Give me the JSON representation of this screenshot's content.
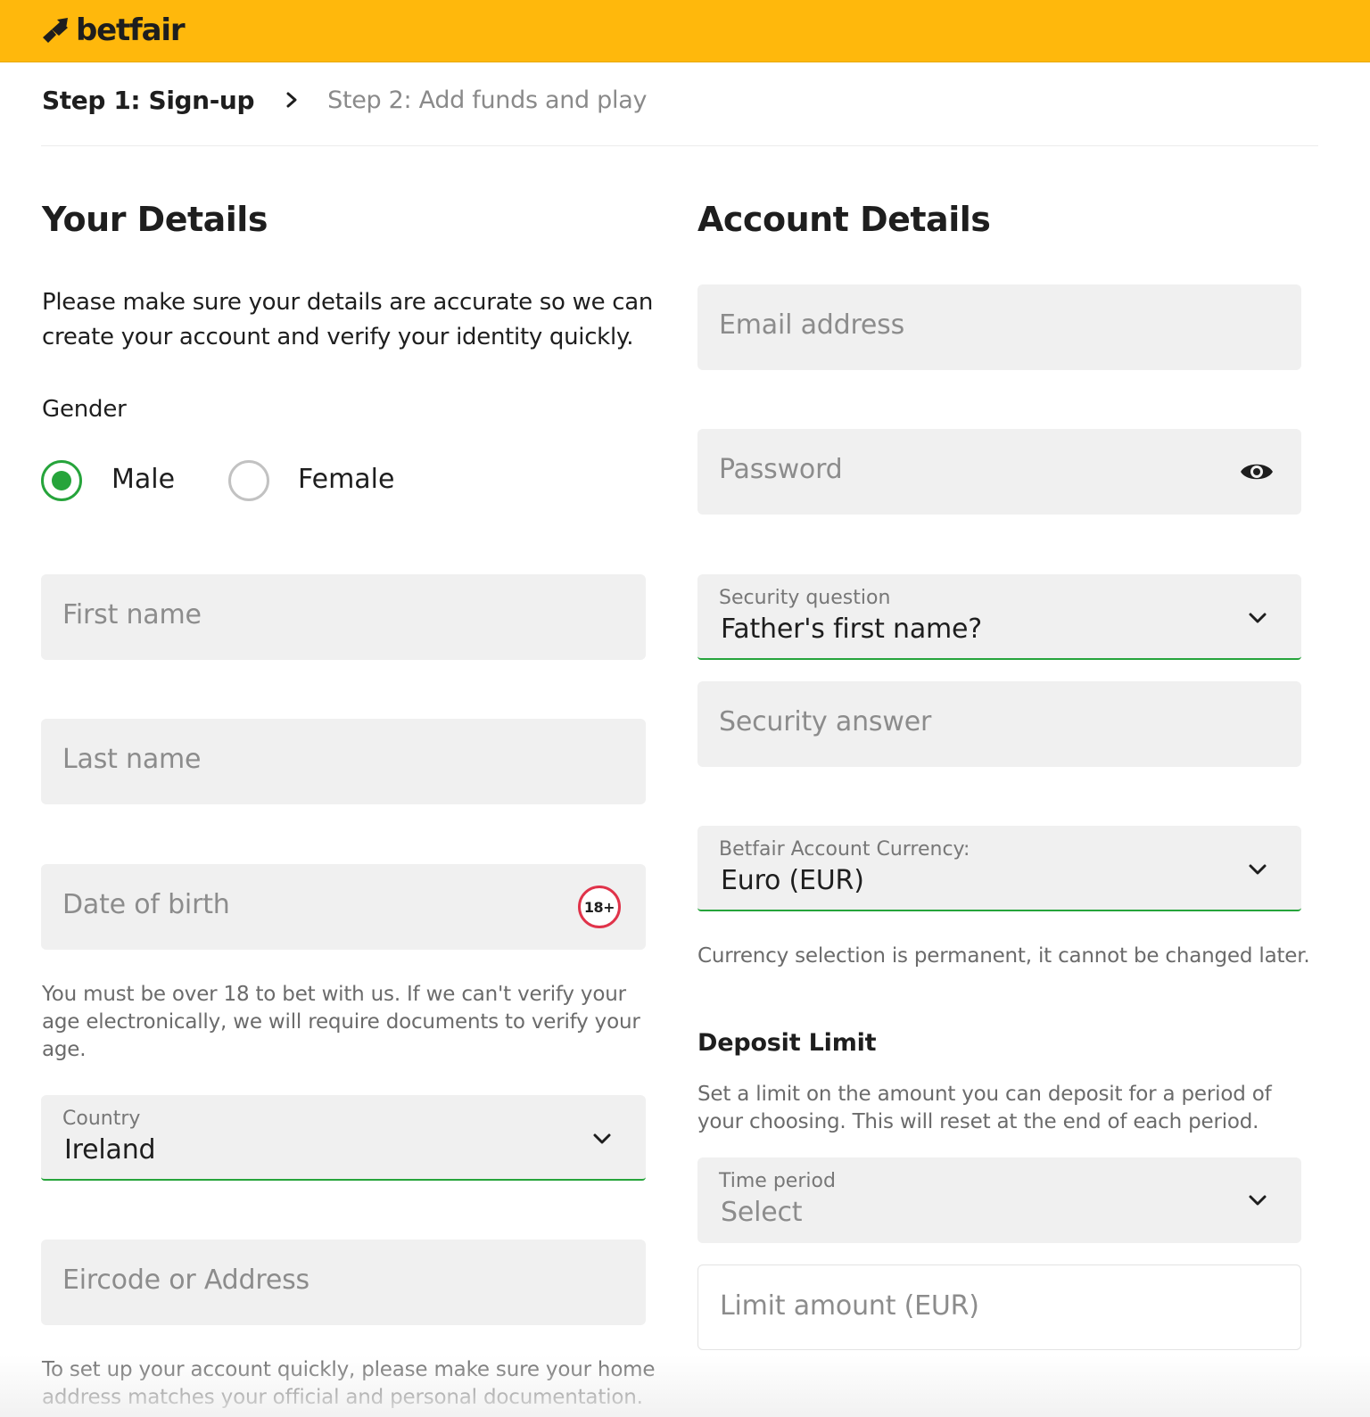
{
  "brand": {
    "name": "betfair",
    "header_color": "#ffb80c",
    "accent_green": "#26a43b",
    "age_badge_color": "#e0334a"
  },
  "steps": {
    "active": "Step 1: Sign-up",
    "inactive": "Step 2: Add funds and play",
    "separator_icon": "chevron-right-icon"
  },
  "your_details": {
    "title": "Your Details",
    "intro": "Please make sure your details are accurate so we can create your account and verify your identity quickly.",
    "gender": {
      "label": "Gender",
      "options": [
        {
          "label": "Male",
          "checked": true
        },
        {
          "label": "Female",
          "checked": false
        }
      ]
    },
    "first_name": {
      "placeholder": "First name",
      "value": ""
    },
    "last_name": {
      "placeholder": "Last name",
      "value": ""
    },
    "dob": {
      "placeholder": "Date of birth",
      "badge": "18+",
      "value": ""
    },
    "dob_help": "You must be over 18 to bet with us. If we can't verify your age electronically, we will require documents to verify your age.",
    "country": {
      "label": "Country",
      "value": "Ireland"
    },
    "address": {
      "placeholder": "Eircode or Address",
      "value": ""
    },
    "address_help": "To set up your account quickly, please make sure your home address matches your official and personal documentation."
  },
  "account_details": {
    "title": "Account Details",
    "email": {
      "placeholder": "Email address",
      "value": ""
    },
    "password": {
      "placeholder": "Password",
      "value": "",
      "toggle_icon": "eye-icon"
    },
    "security_question": {
      "label": "Security question",
      "value": "Father's first name?"
    },
    "security_answer": {
      "placeholder": "Security answer",
      "value": ""
    },
    "currency": {
      "label": "Betfair Account Currency:",
      "value": "Euro (EUR)"
    },
    "currency_help": "Currency selection is permanent, it cannot be changed later.",
    "deposit_limit": {
      "title": "Deposit Limit",
      "description": "Set a limit on the amount you can deposit for a period of your choosing. This will reset at the end of each period.",
      "time_period": {
        "label": "Time period",
        "value": "Select"
      },
      "limit_amount": {
        "placeholder": "Limit amount (EUR)",
        "value": ""
      }
    }
  }
}
